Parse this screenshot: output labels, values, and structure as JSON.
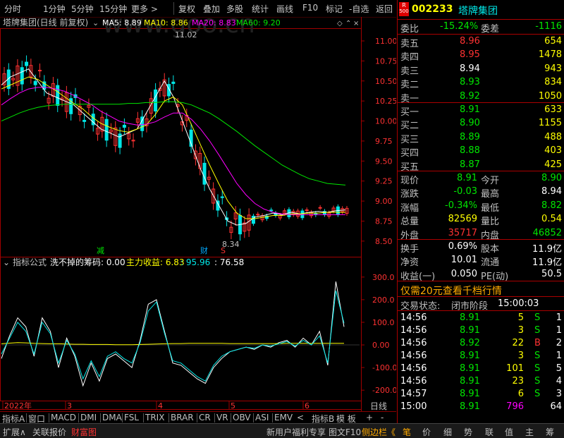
{
  "toolbar": {
    "items": [
      "分时",
      "1分钟",
      "5分钟",
      "15分钟",
      "更多 >",
      "复权",
      "叠加",
      "多股",
      "统计",
      "画线",
      "F10",
      "标记",
      "-自选",
      "返回"
    ]
  },
  "main_chart": {
    "title": "塔牌集团(日线 前复权)",
    "ma5_label": "MA5: 8.89",
    "ma10_label": "MA10: 8.86",
    "ma20_label": "MA20: 8.83",
    "ma60_label": "MA60: 9.20",
    "high_mark": "11.02",
    "low_mark": "8.34",
    "marker_jian": "减",
    "marker_cai": "财",
    "marker_s": "S",
    "watermark": "www.goo.cn",
    "colors": {
      "ma5": "#ffffff",
      "ma10": "#ffff00",
      "ma20": "#ff00ff",
      "ma60": "#00e600",
      "up": "#ff3232",
      "down": "#00e6e6"
    }
  },
  "chart_data": [
    {
      "type": "line",
      "title": "塔牌集团(日线 前复权)",
      "yticks": [
        "11.00",
        "10.75",
        "10.50",
        "10.25",
        "10.00",
        "9.75",
        "9.50",
        "9.25",
        "9.00",
        "8.75",
        "8.50"
      ],
      "ylim": [
        8.34,
        11.15
      ],
      "x_labels": [
        "2022年",
        "3",
        "4",
        "5",
        "6"
      ],
      "series": [
        {
          "name": "MA5",
          "values": [
            10.45,
            10.55,
            10.6,
            10.65,
            10.5,
            10.35,
            10.3,
            10.25,
            10.2,
            10.1,
            10.0,
            9.9,
            9.85,
            9.8,
            9.85,
            9.9,
            10.1,
            10.3,
            10.5,
            10.3,
            10.0,
            9.7,
            9.4,
            9.15,
            8.95,
            8.75,
            8.7,
            8.72,
            8.8,
            8.82,
            8.85,
            8.83,
            8.86,
            8.84,
            8.86,
            8.87,
            8.86,
            8.88,
            8.89
          ]
        },
        {
          "name": "MA10",
          "values": [
            10.4,
            10.45,
            10.5,
            10.55,
            10.52,
            10.45,
            10.38,
            10.3,
            10.22,
            10.15,
            10.05,
            9.97,
            9.92,
            9.88,
            9.86,
            9.9,
            9.95,
            10.08,
            10.25,
            10.3,
            10.2,
            9.95,
            9.7,
            9.45,
            9.22,
            9.0,
            8.85,
            8.78,
            8.78,
            8.8,
            8.82,
            8.82,
            8.84,
            8.84,
            8.85,
            8.85,
            8.86,
            8.86,
            8.86
          ]
        },
        {
          "name": "MA20",
          "values": [
            10.2,
            10.28,
            10.35,
            10.4,
            10.42,
            10.42,
            10.4,
            10.37,
            10.32,
            10.26,
            10.2,
            10.12,
            10.06,
            10.0,
            9.97,
            9.95,
            9.96,
            9.99,
            10.05,
            10.1,
            10.1,
            10.02,
            9.9,
            9.75,
            9.58,
            9.4,
            9.22,
            9.08,
            8.97,
            8.9,
            8.86,
            8.84,
            8.83,
            8.83,
            8.83,
            8.83,
            8.83,
            8.83,
            8.83
          ]
        },
        {
          "name": "MA60",
          "values": [
            10.0,
            10.05,
            10.1,
            10.14,
            10.17,
            10.19,
            10.2,
            10.21,
            10.21,
            10.21,
            10.21,
            10.21,
            10.21,
            10.21,
            10.22,
            10.22,
            10.23,
            10.23,
            10.24,
            10.24,
            10.23,
            10.2,
            10.15,
            10.1,
            10.03,
            9.95,
            9.87,
            9.78,
            9.69,
            9.61,
            9.53,
            9.45,
            9.39,
            9.33,
            9.28,
            9.25,
            9.22,
            9.21,
            9.2
          ]
        }
      ]
    },
    {
      "type": "line",
      "title": "洗不掉的筹码",
      "yticks": [
        "300.0",
        "200.0",
        "100.0",
        "0.00",
        "-100.0",
        "-200.0"
      ],
      "ylim": [
        -240,
        340
      ],
      "series": [
        {
          "name": "洗不掉的筹码",
          "values": [
            -60,
            40,
            120,
            80,
            -50,
            120,
            60,
            -100,
            30,
            -50,
            -180,
            -80,
            -160,
            -60,
            -40,
            -70,
            -100,
            20,
            180,
            200,
            60,
            -80,
            -90,
            -120,
            -150,
            -170,
            -100,
            -60,
            -30,
            -20,
            -10,
            -20,
            0,
            -10,
            10,
            20,
            -10,
            30,
            0,
            60,
            -90,
            280,
            80
          ]
        },
        {
          "name": "主力收益",
          "values": [
            5,
            8,
            10,
            9,
            7,
            6,
            5,
            5,
            4,
            3,
            3,
            2,
            2,
            2,
            1,
            1,
            1,
            2,
            3,
            4,
            5,
            6,
            6,
            7,
            7,
            7,
            7,
            7,
            6,
            6,
            6,
            6,
            6,
            6,
            6,
            7,
            7,
            7,
            7,
            7,
            7,
            7,
            7
          ]
        },
        {
          "name": "95.96",
          "values": [
            -40,
            30,
            100,
            60,
            -40,
            100,
            50,
            -80,
            20,
            -40,
            -150,
            -70,
            -140,
            -50,
            -30,
            -60,
            -80,
            10,
            150,
            190,
            50,
            -70,
            -80,
            -110,
            -140,
            -160,
            -90,
            -50,
            -30,
            -20,
            -10,
            -15,
            0,
            -5,
            5,
            15,
            -5,
            20,
            0,
            40,
            -80,
            240,
            96
          ]
        }
      ]
    }
  ],
  "sub_chart": {
    "header_name": "指标公式",
    "formula_label": "洗不掉的筹码: 0.00",
    "zhuli_label": "主力收益: 6.83",
    "val1_label": ": 95.96",
    "val2_label": ": 76.58"
  },
  "tabs": {
    "items": [
      "指标A",
      "窗口",
      "MACD",
      "DMI",
      "DMA",
      "FSL",
      "TRIX",
      "BRAR",
      "CR",
      "VR",
      "OBV",
      "ASI",
      "EMV",
      "<",
      "指标B",
      "模 板",
      "+",
      "-"
    ],
    "right_label": "日线"
  },
  "status": {
    "left_items": [
      "扩展∧",
      "关联报价",
      "财富图"
    ],
    "right_items": [
      "新用户福利专享",
      "图文F10",
      "侧边栏《",
      "笔",
      "价",
      "细",
      "势",
      "联",
      "值",
      "主",
      "筹"
    ]
  },
  "quote": {
    "r_badge_top": "R",
    "r_badge_bottom": "500",
    "code": "002233",
    "name": "塔牌集团",
    "weibi_label": "委比",
    "weibi_value": "-15.24%",
    "weicha_label": "委差",
    "weicha_value": "-1116",
    "asks": [
      {
        "label": "卖五",
        "price": "8.96",
        "vol": "654"
      },
      {
        "label": "卖四",
        "price": "8.95",
        "vol": "1478"
      },
      {
        "label": "卖三",
        "price": "8.94",
        "vol": "943"
      },
      {
        "label": "卖二",
        "price": "8.93",
        "vol": "834"
      },
      {
        "label": "卖一",
        "price": "8.92",
        "vol": "1050"
      }
    ],
    "bids": [
      {
        "label": "买一",
        "price": "8.91",
        "vol": "633"
      },
      {
        "label": "买二",
        "price": "8.90",
        "vol": "1155"
      },
      {
        "label": "买三",
        "price": "8.89",
        "vol": "488"
      },
      {
        "label": "买四",
        "price": "8.88",
        "vol": "403"
      },
      {
        "label": "买五",
        "price": "8.87",
        "vol": "425"
      }
    ],
    "stats": [
      {
        "l1": "现价",
        "v1": "8.91",
        "l2": "今开",
        "v2": "8.90"
      },
      {
        "l1": "涨跌",
        "v1": "-0.03",
        "l2": "最高",
        "v2": "8.94"
      },
      {
        "l1": "涨幅",
        "v1": "-0.34%",
        "l2": "最低",
        "v2": "8.82"
      },
      {
        "l1": "总量",
        "v1": "82569",
        "l2": "量比",
        "v2": "0.54"
      },
      {
        "l1": "外盘",
        "v1": "35717",
        "l2": "内盘",
        "v2": "46852"
      }
    ],
    "stats2": [
      {
        "l1": "换手",
        "v1": "0.69%",
        "l2": "股本",
        "v2": "11.9亿"
      },
      {
        "l1": "净资",
        "v1": "10.01",
        "l2": "流通",
        "v2": "11.9亿"
      },
      {
        "l1": "收益(一)",
        "v1": "0.050",
        "l2": "PE(动)",
        "v2": "50.5"
      }
    ],
    "promo": "仅需20元查看千档行情",
    "trade_state_label": "交易状态:",
    "trade_state_value": "闭市阶段",
    "trade_state_time": "15:00:03",
    "ticks": [
      {
        "t": "14:56",
        "p": "8.91",
        "v": "5",
        "bs": "S",
        "n": "1"
      },
      {
        "t": "14:56",
        "p": "8.91",
        "v": "3",
        "bs": "S",
        "n": "1"
      },
      {
        "t": "14:56",
        "p": "8.92",
        "v": "22",
        "bs": "B",
        "n": "2"
      },
      {
        "t": "14:56",
        "p": "8.91",
        "v": "3",
        "bs": "S",
        "n": "1"
      },
      {
        "t": "14:56",
        "p": "8.91",
        "v": "101",
        "bs": "S",
        "n": "5"
      },
      {
        "t": "14:56",
        "p": "8.91",
        "v": "23",
        "bs": "S",
        "n": "4"
      },
      {
        "t": "14:57",
        "p": "8.91",
        "v": "6",
        "bs": "S",
        "n": "3"
      },
      {
        "t": "15:00",
        "p": "8.91",
        "v": "796",
        "bs": "",
        "n": "64"
      }
    ]
  }
}
